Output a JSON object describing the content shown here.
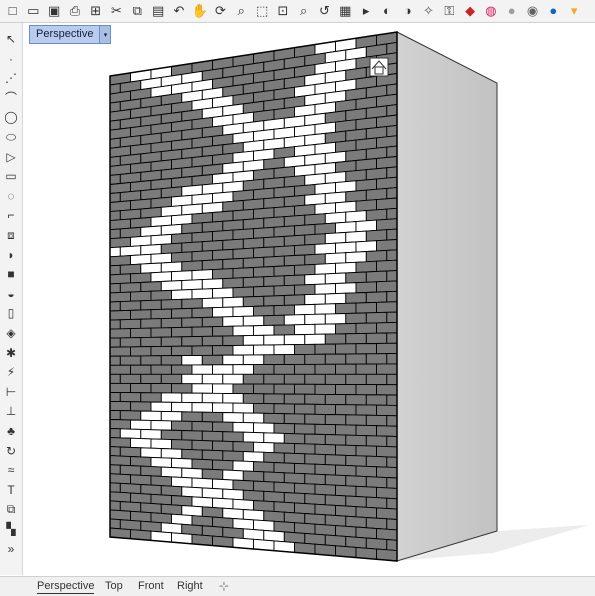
{
  "toolbar": {
    "items": [
      {
        "name": "new-file-icon",
        "glyph": "□"
      },
      {
        "name": "open-file-icon",
        "glyph": "▭"
      },
      {
        "name": "save-icon",
        "glyph": "▣"
      },
      {
        "name": "print-icon",
        "glyph": "⎙"
      },
      {
        "name": "import-icon",
        "glyph": "⊞"
      },
      {
        "name": "cut-icon",
        "glyph": "✂"
      },
      {
        "name": "copy-icon",
        "glyph": "⧉"
      },
      {
        "name": "paste-icon",
        "glyph": "▤"
      },
      {
        "name": "undo-icon",
        "glyph": "↶"
      },
      {
        "name": "pan-icon",
        "glyph": "✋"
      },
      {
        "name": "rotate-view-icon",
        "glyph": "⟳"
      },
      {
        "name": "zoom-icon",
        "glyph": "⌕"
      },
      {
        "name": "zoom-window-icon",
        "glyph": "⬚"
      },
      {
        "name": "zoom-extents-icon",
        "glyph": "⊡"
      },
      {
        "name": "zoom-selected-icon",
        "glyph": "⌕"
      },
      {
        "name": "undo-view-icon",
        "glyph": "↺"
      },
      {
        "name": "grid-icon",
        "glyph": "▦"
      },
      {
        "name": "select-filter-icon",
        "glyph": "▸"
      },
      {
        "name": "hide-icon",
        "glyph": "◐"
      },
      {
        "name": "show-icon",
        "glyph": "◑"
      },
      {
        "name": "lightbulb-icon",
        "glyph": "✧"
      },
      {
        "name": "lock-icon",
        "glyph": "⚿"
      },
      {
        "name": "layer-color-icon",
        "glyph": "◆"
      },
      {
        "name": "color-wheel-icon",
        "glyph": "◍"
      },
      {
        "name": "shaded-sphere-icon",
        "glyph": "●"
      },
      {
        "name": "rendered-sphere-icon",
        "glyph": "◉"
      },
      {
        "name": "render-sphere-icon",
        "glyph": "●"
      },
      {
        "name": "more-tools-icon",
        "glyph": "▾"
      }
    ],
    "colors": {
      "save-icon": "#333333",
      "undo-icon": "#333333",
      "layer-color-icon": "#c62828",
      "color-wheel-icon": "#d81b60",
      "shaded-sphere-icon": "#9e9e9e",
      "rendered-sphere-icon": "#616161",
      "render-sphere-icon": "#1565c0",
      "more-tools-icon": "#f9a825",
      "lightbulb-icon": "#555555"
    }
  },
  "sidebar": {
    "items": [
      {
        "name": "select-arrow-icon",
        "glyph": "↖"
      },
      {
        "name": "point-icon",
        "glyph": "·"
      },
      {
        "name": "polyline-icon",
        "glyph": "⋰"
      },
      {
        "name": "curve-icon",
        "glyph": "⌒"
      },
      {
        "name": "circle-icon",
        "glyph": "◯"
      },
      {
        "name": "ellipse-icon",
        "glyph": "⬭"
      },
      {
        "name": "polygon-icon",
        "glyph": "▷"
      },
      {
        "name": "rectangle-icon",
        "glyph": "▭"
      },
      {
        "name": "arc-icon",
        "glyph": "◌"
      },
      {
        "name": "fillet-icon",
        "glyph": "⌐"
      },
      {
        "name": "transform-icon",
        "glyph": "⧈"
      },
      {
        "name": "surface-icon",
        "glyph": "◗"
      },
      {
        "name": "box-solid-icon",
        "glyph": "■"
      },
      {
        "name": "boolean-icon",
        "glyph": "◒"
      },
      {
        "name": "cylinder-icon",
        "glyph": "▯"
      },
      {
        "name": "mesh-icon",
        "glyph": "◈"
      },
      {
        "name": "gear-icon",
        "glyph": "✱"
      },
      {
        "name": "lightning-icon",
        "glyph": "⚡"
      },
      {
        "name": "dimension-icon",
        "glyph": "⊢"
      },
      {
        "name": "align-icon",
        "glyph": "⊥"
      },
      {
        "name": "render-icon",
        "glyph": "♣"
      },
      {
        "name": "rotate-icon",
        "glyph": "↻"
      },
      {
        "name": "sweep-icon",
        "glyph": "≈"
      },
      {
        "name": "text-icon",
        "glyph": "T"
      },
      {
        "name": "group-icon",
        "glyph": "⧉"
      },
      {
        "name": "block-icon",
        "glyph": "▚"
      },
      {
        "name": "expand-icon",
        "glyph": "»"
      }
    ]
  },
  "viewport": {
    "title": "Perspective",
    "dropdown_glyph": "▾",
    "orientation_cube_glyph": "⌂",
    "colors": {
      "dark_brick": "#7b7b7b",
      "light_brick": "#ffffff",
      "mortar": "#000000",
      "side_face": "#cfcfcf",
      "shadow": "#eeeeee",
      "title_bg": "#b9ccee"
    }
  },
  "bottom_tabs": [
    "Perspective",
    "Top",
    "Front",
    "Right"
  ],
  "add_tab_glyph": "⊹"
}
